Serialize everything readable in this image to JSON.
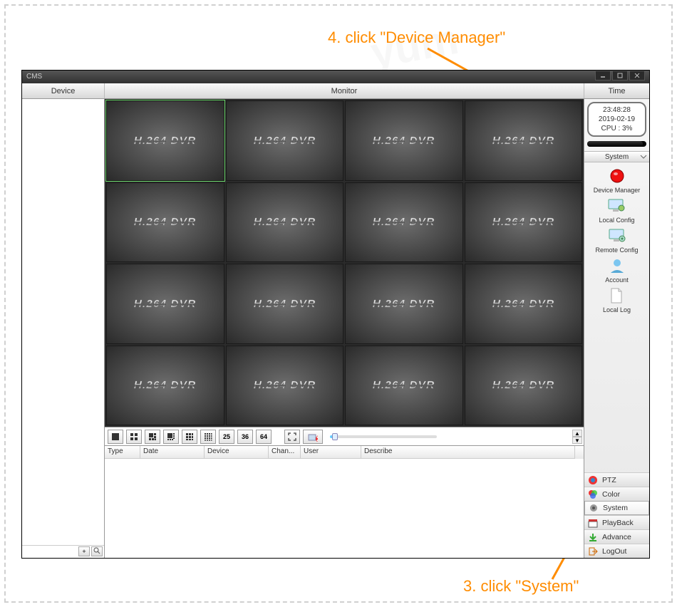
{
  "annotation": {
    "top": "4. click \"Device Manager\"",
    "bottom": "3. click \"System\""
  },
  "window": {
    "title": "CMS"
  },
  "header": {
    "device": "Device",
    "monitor": "Monitor",
    "time": "Time"
  },
  "clock": {
    "time": "23:48:28",
    "date": "2019-02-19",
    "cpu": "CPU : 3%"
  },
  "system_panel": {
    "title": "System",
    "items": [
      {
        "label": "Device Manager"
      },
      {
        "label": "Local Config"
      },
      {
        "label": "Remote Config"
      },
      {
        "label": "Account"
      },
      {
        "label": "Local Log"
      }
    ]
  },
  "menu": [
    {
      "label": "PTZ"
    },
    {
      "label": "Color"
    },
    {
      "label": "System"
    },
    {
      "label": "PlayBack"
    },
    {
      "label": "Advance"
    },
    {
      "label": "LogOut"
    }
  ],
  "toolbar_numbers": [
    "25",
    "36",
    "64"
  ],
  "log_columns": [
    "Type",
    "Date",
    "Device",
    "Chan...",
    "User",
    "Describe"
  ],
  "camera_label": "H.264 DVR"
}
